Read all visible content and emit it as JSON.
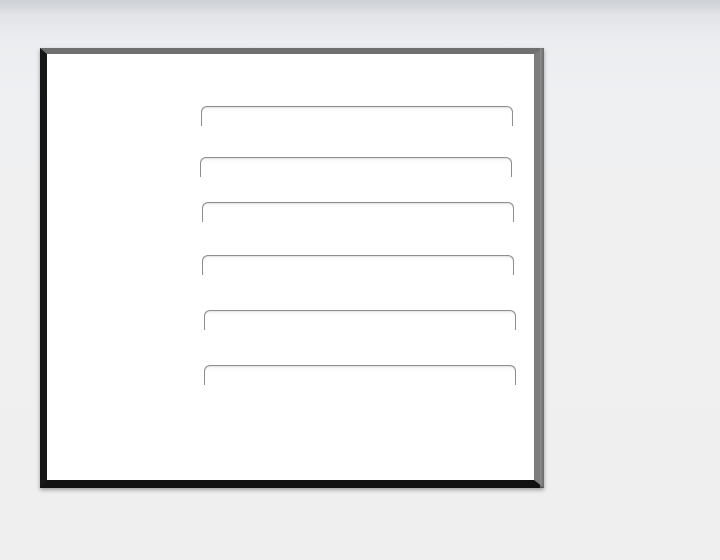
{
  "form": {
    "fields": [
      {
        "value": "",
        "placeholder": ""
      },
      {
        "value": "",
        "placeholder": ""
      },
      {
        "value": "",
        "placeholder": ""
      },
      {
        "value": "",
        "placeholder": ""
      },
      {
        "value": "",
        "placeholder": ""
      },
      {
        "value": "",
        "placeholder": ""
      }
    ]
  },
  "colors": {
    "background": "#efefef",
    "panel": "#ffffff",
    "frame_dark": "#161616",
    "frame_light": "#7d7d7d",
    "field_border": "#8e8e8e"
  }
}
